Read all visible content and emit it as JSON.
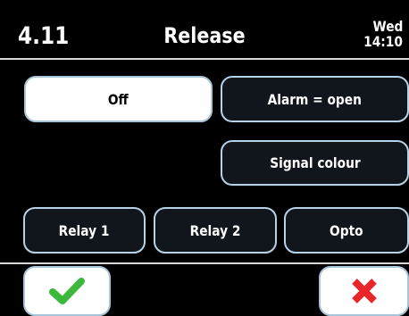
{
  "header": {
    "menu_number": "4.11",
    "title": "Release",
    "day": "Wed",
    "time": "14:10"
  },
  "options": {
    "off": "Off",
    "alarm_open": "Alarm = open",
    "signal_colour": "Signal colour",
    "relay1": "Relay 1",
    "relay2": "Relay 2",
    "opto": "Opto"
  },
  "selected_option": "Off",
  "footer": {
    "confirm_icon": "checkmark-icon",
    "cancel_icon": "cross-icon"
  },
  "colors": {
    "background": "#000000",
    "button_border": "#b7d2e6",
    "selected_bg": "#ffffff",
    "confirm_green": "#3db83d",
    "cancel_red": "#e8262a"
  }
}
